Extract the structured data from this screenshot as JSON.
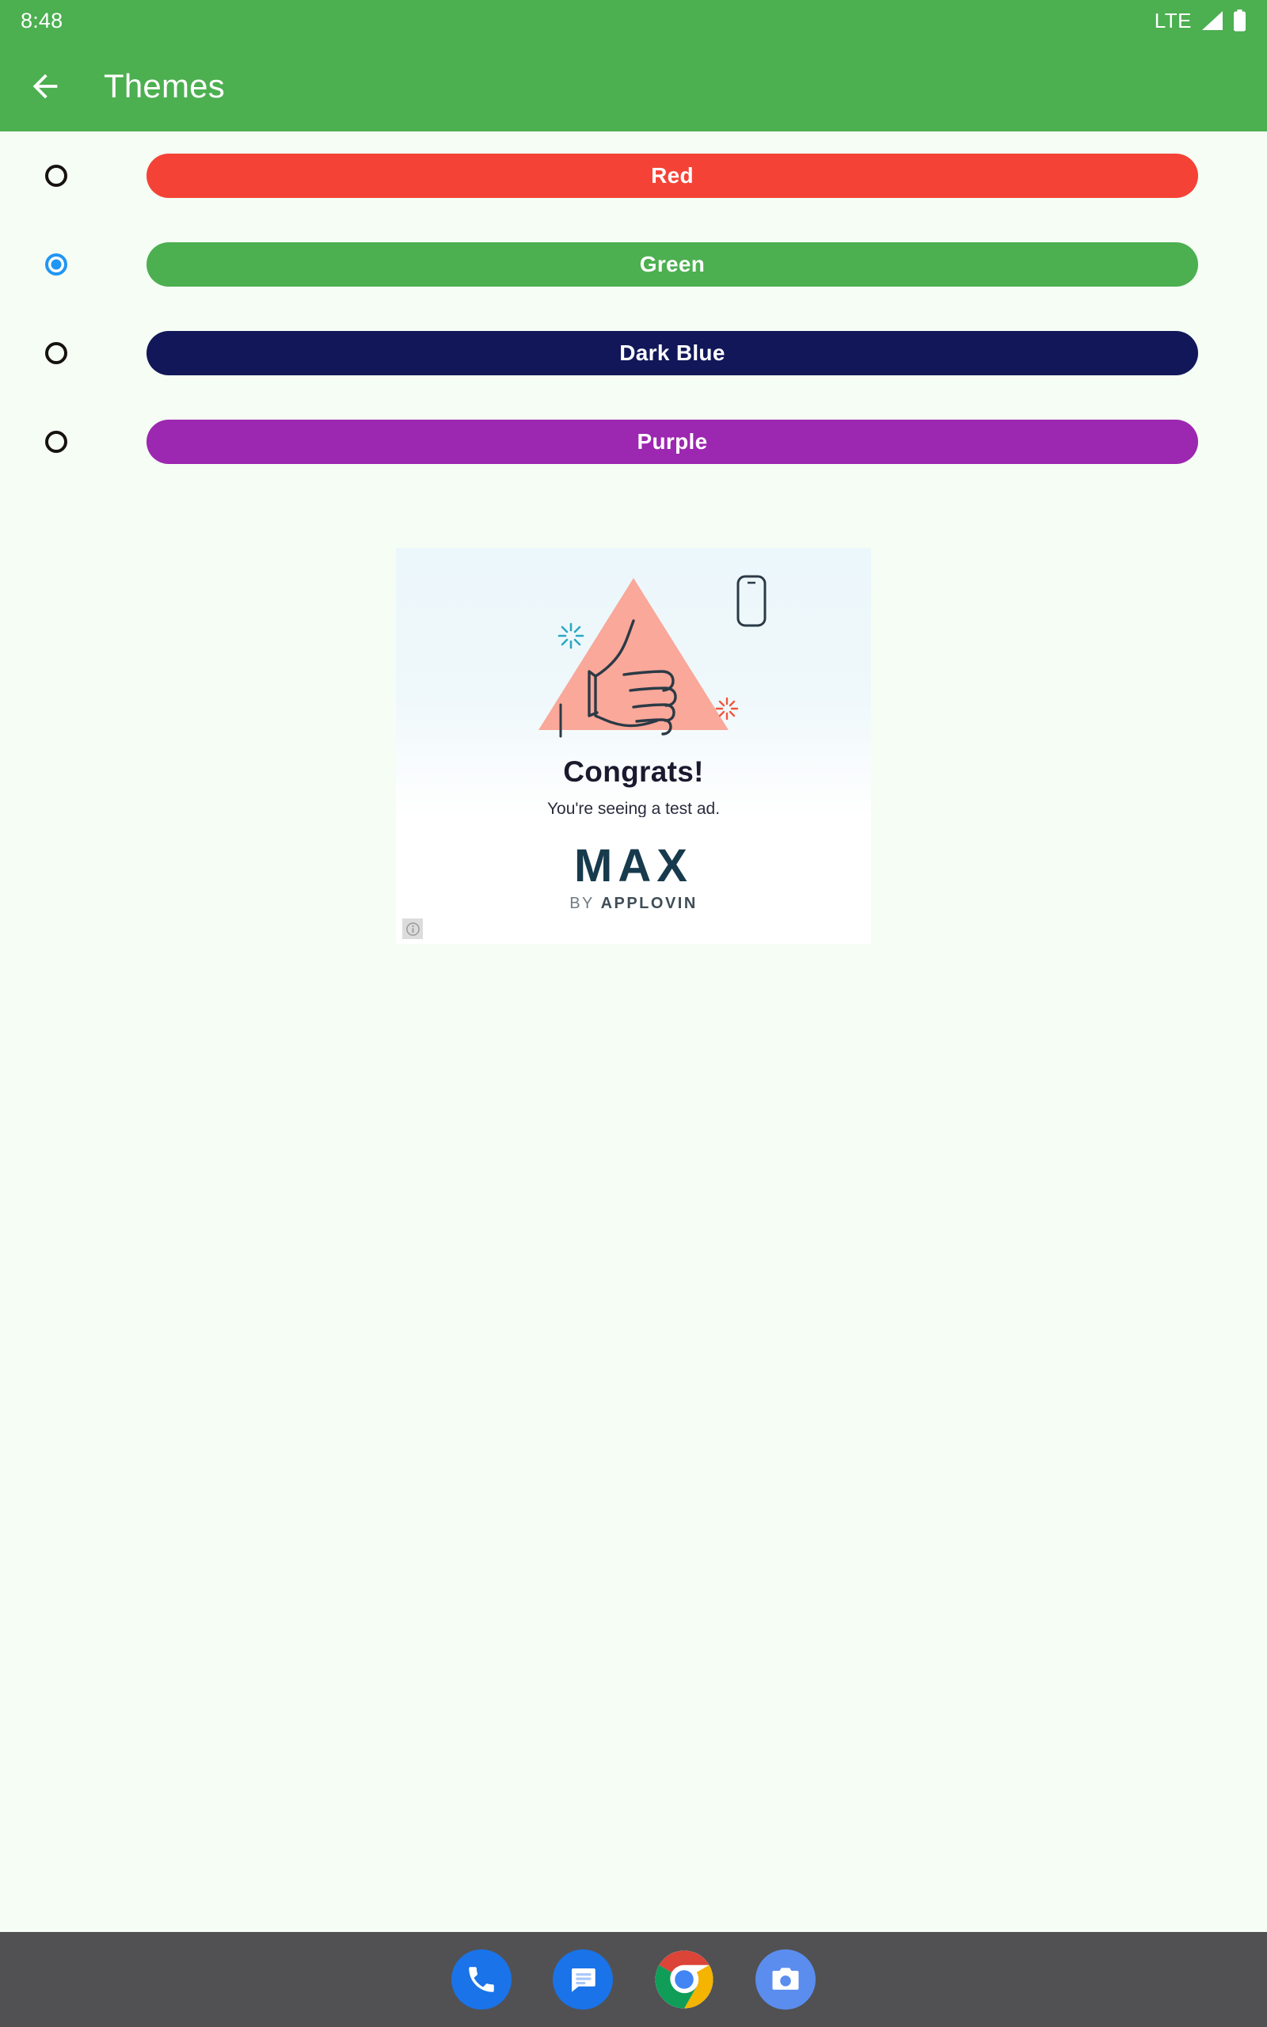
{
  "statusbar": {
    "time": "8:48",
    "network_label": "LTE",
    "signal_icon": "signal-bars-icon",
    "battery_icon": "battery-full-icon"
  },
  "appbar": {
    "back_icon": "back-arrow-icon",
    "title": "Themes",
    "background_color": "#4caf50"
  },
  "themes": {
    "selected": "Green",
    "options": [
      {
        "label": "Red",
        "color": "#f44336",
        "selected": false
      },
      {
        "label": "Green",
        "color": "#4caf50",
        "selected": true
      },
      {
        "label": "Dark Blue",
        "color": "#111759",
        "selected": false
      },
      {
        "label": "Purple",
        "color": "#9c27b0",
        "selected": false
      }
    ]
  },
  "ad": {
    "headline": "Congrats!",
    "subtext": "You're seeing a test ad.",
    "logo": "MAX",
    "byline_prefix": "BY ",
    "byline_brand": "APPLOVIN",
    "info_badge_icon": "info-circle-icon",
    "thumbs_up_icon": "thumbs-up-icon",
    "phone_icon": "phone-outline-icon",
    "sparkle_teal_icon": "sparkle-icon",
    "sparkle_orange_icon": "sparkle-icon",
    "triangle_color": "#f9a89a",
    "logo_color": "#173a4d"
  },
  "dock": {
    "items": [
      {
        "name": "phone",
        "icon": "phone-icon",
        "label": "Phone"
      },
      {
        "name": "messages",
        "icon": "messages-icon",
        "label": "Messages"
      },
      {
        "name": "chrome",
        "icon": "chrome-icon",
        "label": "Chrome"
      },
      {
        "name": "camera",
        "icon": "camera-icon",
        "label": "Camera"
      }
    ],
    "background_color": "#515153"
  },
  "page": {
    "background_color": "#f5fdf5"
  }
}
